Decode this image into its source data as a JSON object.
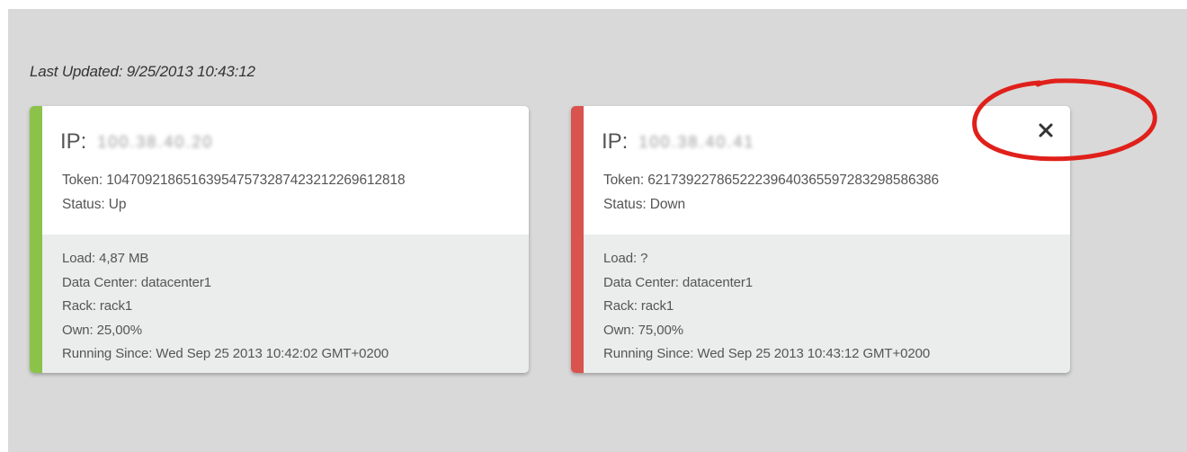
{
  "last_updated": "Last Updated: 9/25/2013 10:43:12",
  "colors": {
    "up": "#8bc34a",
    "down": "#d9534f",
    "annotation": "#e0201b"
  },
  "nodes": [
    {
      "ip_label": "IP:",
      "ip_value": "100.38.40.20",
      "token": "Token: 104709218651639547573287423212269612818",
      "status": "Status: Up",
      "load": "Load: 4,87 MB",
      "data_center": "Data Center: datacenter1",
      "rack": "Rack: rack1",
      "own": "Own: 25,00%",
      "running_since": "Running Since: Wed Sep 25 2013 10:42:02 GMT+0200",
      "has_close": false
    },
    {
      "ip_label": "IP:",
      "ip_value": "100.38.40.41",
      "token": "Token: 62173922786522239640365597283298586386",
      "status": "Status: Down",
      "load": "Load: ?",
      "data_center": "Data Center: datacenter1",
      "rack": "Rack: rack1",
      "own": "Own: 75,00%",
      "running_since": "Running Since: Wed Sep 25 2013 10:43:12 GMT+0200",
      "has_close": true,
      "close_icon": "close-icon"
    }
  ]
}
